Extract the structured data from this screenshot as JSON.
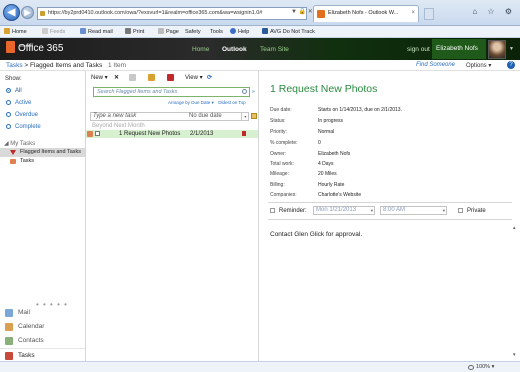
{
  "browser": {
    "address_url": "https://by2prd0410.outlook.com/owa/?exsvurl=1&realm=office365.com&wa=wsignin1.0#",
    "tab_label": "Elizabeth Nofs - Outlook W...",
    "back_glyph": "◀",
    "fwd_glyph": "▶",
    "addr_icons": "▼ 🔒 ✕",
    "close_glyph": "×",
    "window_icons": "⌂ ☆ ⚙"
  },
  "commandbar": {
    "home": "Home",
    "feeds": "Feeds",
    "read_mail": "Read mail",
    "print": "Print",
    "page": "Page",
    "safety": "Safety",
    "tools": "Tools",
    "help": "Help",
    "avg": "AVG Do Not Track"
  },
  "o365": {
    "brand_small": "Microsoft",
    "brand": "Office 365",
    "nav": [
      "Home",
      "Outlook",
      "Team Site"
    ],
    "sign_out": "sign out",
    "user": "Elizabeth Nofs",
    "dropdown_glyph": "▼"
  },
  "subheader": {
    "breadcrumb_root": "Tasks",
    "breadcrumb_sep": " > ",
    "breadcrumb_current": "Flagged Items and Tasks",
    "count": "1 Item",
    "find_someone": "Find Someone",
    "options": "Options ▾",
    "help": "?"
  },
  "leftpane": {
    "show_label": "Show:",
    "filters": [
      {
        "label": "All",
        "selected": true
      },
      {
        "label": "Active",
        "selected": false
      },
      {
        "label": "Overdue",
        "selected": false
      },
      {
        "label": "Complete",
        "selected": false
      }
    ],
    "my_tasks_header": "◢ My Tasks",
    "folders": [
      "Flagged Items and Tasks",
      "Tasks"
    ],
    "dots": "• • • • •",
    "modules": [
      "Mail",
      "Calendar",
      "Contacts",
      "Tasks"
    ]
  },
  "midpane": {
    "new": "New ▾",
    "delete": "✕",
    "view": "View ▾",
    "search_placeholder": "Search Flagged Items and Tasks",
    "arrange_by": "Arrange by Due Date ▾",
    "oldest_on_top": "Oldest on Top",
    "new_task_placeholder": "Type a new task",
    "new_task_due": "No due date",
    "group_header": "Beyond Next Month",
    "tasks": [
      {
        "name": "1 Request New Photos",
        "date": "2/1/2013"
      }
    ],
    "chevron": "»",
    "dropdown_glyph": "▾"
  },
  "reading": {
    "title": "1 Request New Photos",
    "properties": [
      {
        "label": "Due date:",
        "value": "Starts on 1/14/2013, due on 2/1/2013."
      },
      {
        "label": "Status:",
        "value": "In progress"
      },
      {
        "label": "Priority:",
        "value": "Normal"
      },
      {
        "label": "% complete:",
        "value": "0"
      },
      {
        "label": "Owner:",
        "value": "Elizabeth Nofs"
      },
      {
        "label": "Total work:",
        "value": "4 Days"
      },
      {
        "label": "Mileage:",
        "value": "20 Miles"
      },
      {
        "label": "Billing:",
        "value": "Hourly Rate"
      },
      {
        "label": "Companies:",
        "value": "Charlotte's Website"
      }
    ],
    "reminder_label": "Reminder:",
    "reminder_date": "Mon 1/21/2013",
    "reminder_time": "8:00 AM",
    "private_label": "Private",
    "body": "Contact Glen Glick for approval.",
    "scroll_up": "▲",
    "scroll_down": "▼"
  },
  "status": {
    "zoom": "100% ▾"
  }
}
